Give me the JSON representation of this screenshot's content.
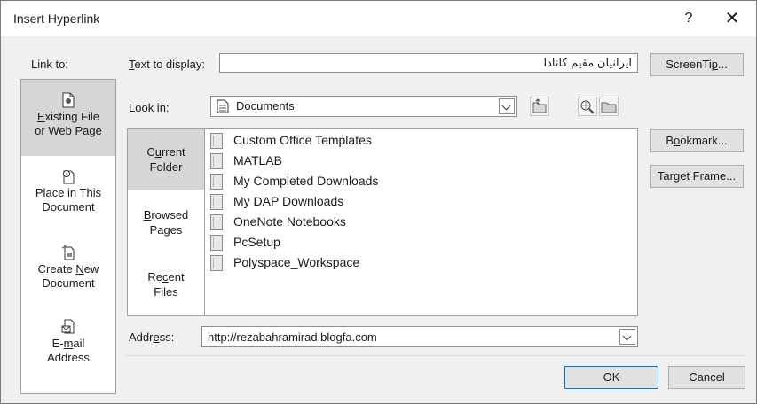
{
  "dialog": {
    "title": "Insert Hyperlink",
    "help_label": "?",
    "close_label": "✕"
  },
  "link_to": {
    "label": "Link to:",
    "items": [
      {
        "line1": "Existing File",
        "line2": "or Web Page",
        "icon": "existing-file-icon",
        "selected": true
      },
      {
        "line1": "Place in This",
        "line2": "Document",
        "icon": "place-in-document-icon",
        "selected": false
      },
      {
        "line1": "Create New",
        "line2": "Document",
        "icon": "create-new-document-icon",
        "selected": false
      },
      {
        "line1": "E-mail",
        "line2": "Address",
        "icon": "email-icon",
        "selected": false
      }
    ]
  },
  "text_to_display": {
    "label": "Text to display:",
    "value": "ایرانیان مقیم کانادا"
  },
  "look_in": {
    "label": "Look in:",
    "value": "Documents",
    "icon": "documents-folder-icon"
  },
  "toolbar": {
    "up_folder_icon": "up-folder-icon",
    "browse_web_icon": "browse-web-icon",
    "browse_file_icon": "browse-file-icon"
  },
  "side_tabs": [
    {
      "line1": "Current",
      "line2": "Folder",
      "selected": true
    },
    {
      "line1": "Browsed",
      "line2": "Pages",
      "selected": false
    },
    {
      "line1": "Recent",
      "line2": "Files",
      "selected": false
    }
  ],
  "files": [
    "Custom Office Templates",
    "MATLAB",
    "My Completed Downloads",
    "My DAP Downloads",
    "OneNote Notebooks",
    "PcSetup",
    "Polyspace_Workspace"
  ],
  "address": {
    "label": "Address:",
    "value": "http://rezabahramirad.blogfa.com"
  },
  "buttons": {
    "screentip": "ScreenTip...",
    "bookmark": "Bookmark...",
    "target_frame": "Target Frame...",
    "ok": "OK",
    "cancel": "Cancel"
  }
}
